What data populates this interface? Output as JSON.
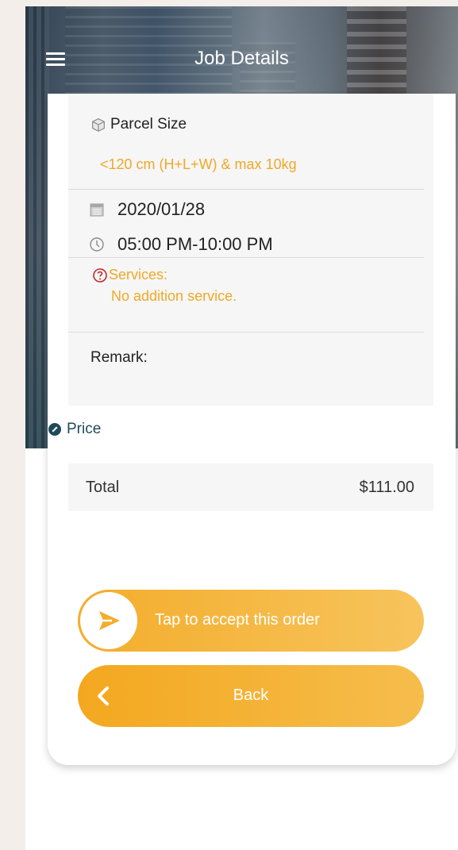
{
  "header": {
    "title": "Job Details",
    "menu_icon": "hamburger-menu-icon"
  },
  "parcel": {
    "label": "Parcel Size",
    "icon": "box-icon",
    "value": "<120 cm (H+L+W) & max 10kg"
  },
  "schedule": {
    "date": "2020/01/28",
    "date_icon": "calendar-icon",
    "time": "05:00 PM-10:00 PM",
    "time_icon": "clock-icon"
  },
  "services": {
    "label": "Services:",
    "icon": "question-circle-icon",
    "value": "No addition service."
  },
  "remark": {
    "label": "Remark:"
  },
  "price": {
    "label": "Price",
    "icon": "price-tag-icon",
    "total_label": "Total",
    "total_value": "$111.00"
  },
  "actions": {
    "accept_label": "Tap to accept this order",
    "accept_icon": "send-arrow-icon",
    "back_label": "Back",
    "back_icon": "chevron-left-icon"
  },
  "colors": {
    "accent": "#f0a826",
    "button": "#f3ad2c",
    "price_header": "#1f4a5a",
    "error_icon": "#c0282d",
    "panel_bg": "#f6f6f6",
    "page_bg": "#f4eeea"
  }
}
